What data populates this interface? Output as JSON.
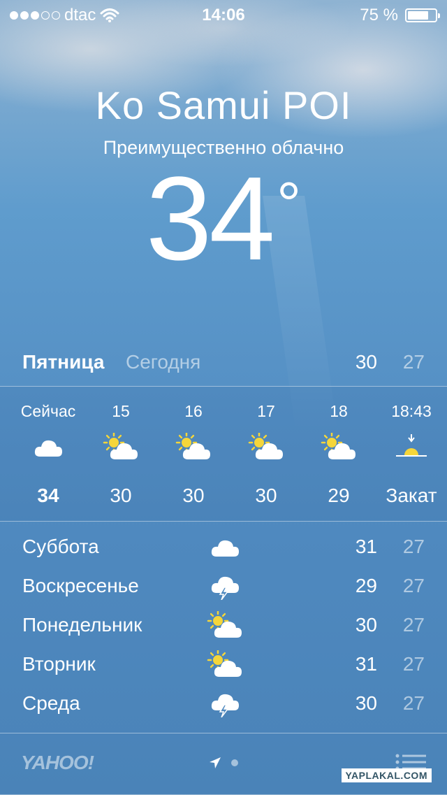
{
  "status_bar": {
    "carrier": "dtac",
    "signal_bars": 3,
    "signal_total": 5,
    "time": "14:06",
    "battery_text": "75 %",
    "battery_level": 0.75
  },
  "weather": {
    "city": "Ko Samui POI",
    "condition": "Преимущественно облачно",
    "temperature": "34",
    "degree_symbol": "°"
  },
  "today": {
    "day": "Пятница",
    "label": "Сегодня",
    "high": "30",
    "low": "27"
  },
  "hourly": [
    {
      "time": "Сейчас",
      "icon": "cloud-icon",
      "temp": "34",
      "bold": true
    },
    {
      "time": "15",
      "icon": "partly-sunny-icon",
      "temp": "30"
    },
    {
      "time": "16",
      "icon": "partly-sunny-icon",
      "temp": "30"
    },
    {
      "time": "17",
      "icon": "partly-sunny-icon",
      "temp": "30"
    },
    {
      "time": "18",
      "icon": "partly-sunny-icon",
      "temp": "29"
    },
    {
      "time": "18:43",
      "icon": "sunset-icon",
      "temp": "Закат"
    }
  ],
  "daily": [
    {
      "day": "Суббота",
      "icon": "cloud-icon",
      "high": "31",
      "low": "27"
    },
    {
      "day": "Воскресенье",
      "icon": "thunderstorm-icon",
      "high": "29",
      "low": "27"
    },
    {
      "day": "Понедельник",
      "icon": "partly-sunny-icon",
      "high": "30",
      "low": "27"
    },
    {
      "day": "Вторник",
      "icon": "partly-sunny-icon",
      "high": "31",
      "low": "27"
    },
    {
      "day": "Среда",
      "icon": "thunderstorm-icon",
      "high": "30",
      "low": "27"
    }
  ],
  "footer": {
    "provider": "YAHOO!",
    "watermark": "YAPLAKAL.COM"
  },
  "colors": {
    "sun": "#f5d63a",
    "dim_text": "rgba(255,255,255,0.55)"
  }
}
